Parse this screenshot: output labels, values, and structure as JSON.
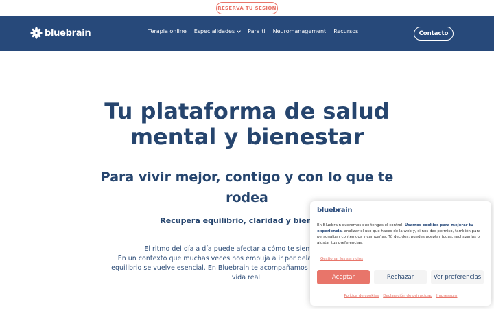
{
  "header": {
    "cta": "RESERVA TU SESIÓN",
    "logo": "bluebrain",
    "menu": [
      {
        "label": "Terapia online"
      },
      {
        "label": "Especialidades"
      },
      {
        "label": "Para ti"
      },
      {
        "label": "Neuromanagement"
      },
      {
        "label": "Recursos"
      }
    ],
    "contact": "Contacto"
  },
  "hero": {
    "title_line1": "Tu plataforma de salud",
    "title_line2": "mental y bienestar",
    "subtitle_line1": "Para vivir mejor, contigo y con lo que te",
    "subtitle_line2": "rodea",
    "tagline": "Recupera equilibrio, claridad y bienestar",
    "body_line1": "El ritmo del día a día puede afectar a cómo te sientes, cómo pi",
    "body_line2": "En un contexto que muchas veces nos empuja a ir por delante de nosotros mis",
    "body_line3": "equilibrio se vuelve esencial. En Bluebrain te acompañamos en ese proceso con ce",
    "body_line4": "vida real."
  },
  "cookie": {
    "logo": "bluebrain",
    "text_pre": "En Bluebrain queremos que tengas el control. ",
    "text_bold": "Usamos cookies para mejorar tu experiencia",
    "text_post": ", analizar el uso que haces de la web y, si nos das permiso, también para personalizar contenidos y campañas. Tú decides: puedes aceptar todas, rechazarlas o ajustar tus preferencias.",
    "manage": "Gestionar los servicios",
    "accept": "Aceptar",
    "reject": "Rechazar",
    "prefs": "Ver preferencias",
    "links": [
      "Política de cookies",
      "Declaración de privacidad",
      "Impressum"
    ]
  },
  "colors": {
    "navy": "#27497a",
    "coral": "#e8756a"
  }
}
